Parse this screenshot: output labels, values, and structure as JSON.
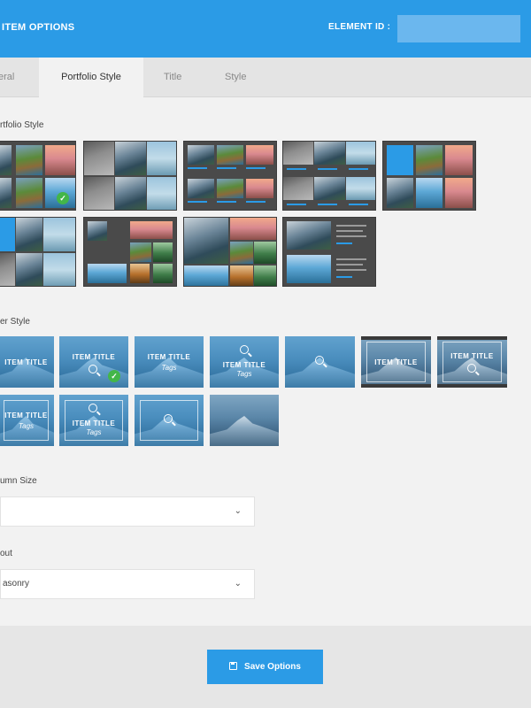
{
  "header": {
    "title": "ITEM OPTIONS",
    "element_id_label": "ELEMENT ID :",
    "element_id_value": ""
  },
  "tabs": [
    {
      "label": "eral",
      "active": false
    },
    {
      "label": "Portfolio Style",
      "active": true
    },
    {
      "label": "Title",
      "active": false
    },
    {
      "label": "Style",
      "active": false
    }
  ],
  "portfolio_style": {
    "label": "rtfolio Style",
    "selected_index": 0
  },
  "hover_style": {
    "label": "er Style",
    "item_title": "ITEM TITLE",
    "tags": "Tags",
    "selected_index": 1
  },
  "column_size": {
    "label": "umn Size",
    "value": ""
  },
  "layout": {
    "label": "out",
    "value": "asonry"
  },
  "footer": {
    "save_label": "Save Options"
  },
  "colors": {
    "accent": "#2b9be6",
    "check": "#43b649",
    "thumb_bg": "#4a4a4a"
  },
  "icons": {
    "select_arrow": "chevron-down-icon",
    "check": "check-circle-icon",
    "zoom": "magnifier-icon",
    "save": "floppy-disk-icon"
  }
}
